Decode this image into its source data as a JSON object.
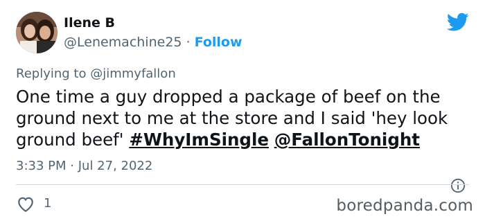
{
  "author": {
    "name": "Ilene B",
    "handle": "@Lenemachine25",
    "separator": "·",
    "follow_label": "Follow"
  },
  "reply": {
    "prefix": "Replying to",
    "to": "@jimmyfallon"
  },
  "tweet": {
    "text": "One time a guy dropped a package of beef on the ground next to me at the store and I said 'hey look ground beef'",
    "hashtag": "#WhyImSingle",
    "mention": "@FallonTonight"
  },
  "meta": {
    "time": "3:33 PM",
    "separator": "·",
    "date": "Jul 27, 2022"
  },
  "stats": {
    "likes": "1"
  },
  "watermark": "boredpanda.com",
  "colors": {
    "twitter_blue": "#1d9bf0",
    "text": "#0f1419",
    "secondary": "#536471"
  },
  "icons": [
    "twitter-bird-icon",
    "info-icon",
    "heart-icon"
  ]
}
